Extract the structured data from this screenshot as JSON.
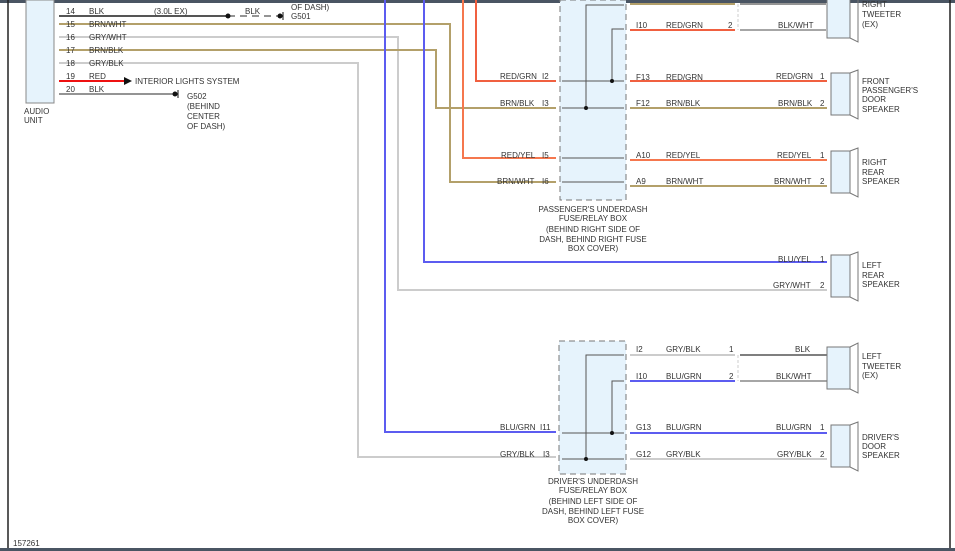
{
  "colors": {
    "red": "#f06040",
    "orange": "#f5774e",
    "brown": "#b3a06a",
    "gray": "#cccccc",
    "blue": "#5c5cf0",
    "black": "#555555",
    "box_fill": "#e6f3fc",
    "frame": "#4a5563"
  },
  "audio_unit": {
    "label1": "AUDIO",
    "label2": "UNIT",
    "pins": [
      {
        "num": "14",
        "wire": "BLK"
      },
      {
        "num": "15",
        "wire": "BRN/WHT"
      },
      {
        "num": "16",
        "wire": "GRY/WHT"
      },
      {
        "num": "17",
        "wire": "BRN/BLK"
      },
      {
        "num": "18",
        "wire": "GRY/BLK"
      },
      {
        "num": "19",
        "wire": "RED"
      },
      {
        "num": "20",
        "wire": "BLK"
      }
    ]
  },
  "pin14_note": "(3.0L EX)",
  "pin14_dash_wire": "BLK",
  "g501": {
    "label": "G501",
    "note": "OF DASH)"
  },
  "pin19_dest": "INTERIOR LIGHTS SYSTEM",
  "g502": {
    "label": "G502",
    "lines": [
      "(BEHIND",
      "CENTER",
      "OF DASH)"
    ]
  },
  "passenger_box": {
    "title": [
      "PASSENGER'S UNDERDASH",
      "FUSE/RELAY BOX"
    ],
    "location": [
      "(BEHIND RIGHT SIDE OF",
      "DASH, BEHIND RIGHT FUSE",
      "BOX COVER)"
    ],
    "inputs": [
      {
        "wire": "RED/GRN",
        "pin": "I2"
      },
      {
        "wire": "BRN/BLK",
        "pin": "I3"
      },
      {
        "wire": "RED/YEL",
        "pin": "I5"
      },
      {
        "wire": "BRN/WHT",
        "pin": "I6"
      }
    ],
    "outputs": [
      {
        "pin": "I10",
        "wire": "RED/GRN"
      },
      {
        "pin": "F13",
        "wire": "RED/GRN"
      },
      {
        "pin": "F12",
        "wire": "BRN/BLK"
      },
      {
        "pin": "A10",
        "wire": "RED/YEL"
      },
      {
        "pin": "A9",
        "wire": "BRN/WHT"
      }
    ]
  },
  "driver_box": {
    "title": [
      "DRIVER'S UNDERDASH",
      "FUSE/RELAY BOX"
    ],
    "location": [
      "(BEHIND LEFT SIDE OF",
      "DASH, BEHIND LEFT FUSE",
      "BOX COVER)"
    ],
    "inputs": [
      {
        "wire": "BLU/GRN",
        "pin": "I11"
      },
      {
        "wire": "GRY/BLK",
        "pin": "I3"
      }
    ],
    "outputs": [
      {
        "pin": "I2",
        "wire": "GRY/BLK"
      },
      {
        "pin": "I10",
        "wire": "BLU/GRN"
      },
      {
        "pin": "G13",
        "wire": "BLU/GRN"
      },
      {
        "pin": "G12",
        "wire": "GRY/BLK"
      }
    ]
  },
  "speakers": [
    {
      "name": [
        "RIGHT",
        "TWEETER",
        "(EX)"
      ],
      "pin2_conn": "2",
      "pin2_wire": "BLK/WHT"
    },
    {
      "name": [
        "FRONT",
        "PASSENGER'S",
        "DOOR",
        "SPEAKER"
      ],
      "pins": [
        {
          "num": "1",
          "wire": "RED/GRN"
        },
        {
          "num": "2",
          "wire": "BRN/BLK"
        }
      ]
    },
    {
      "name": [
        "RIGHT",
        "REAR",
        "SPEAKER"
      ],
      "pins": [
        {
          "num": "1",
          "wire": "RED/YEL"
        },
        {
          "num": "2",
          "wire": "BRN/WHT"
        }
      ]
    },
    {
      "name": [
        "LEFT",
        "REAR",
        "SPEAKER"
      ],
      "pins": [
        {
          "num": "1",
          "wire": "BLU/YEL"
        },
        {
          "num": "2",
          "wire": "GRY/WHT"
        }
      ]
    },
    {
      "name": [
        "LEFT",
        "TWEETER",
        "(EX)"
      ],
      "pins": [
        {
          "num": "1",
          "wire": "BLK"
        },
        {
          "num": "2",
          "wire": "BLK/WHT"
        }
      ]
    },
    {
      "name": [
        "DRIVER'S",
        "DOOR",
        "SPEAKER"
      ],
      "pins": [
        {
          "num": "1",
          "wire": "BLU/GRN"
        },
        {
          "num": "2",
          "wire": "GRY/BLK"
        }
      ]
    }
  ],
  "figure_id": "157261"
}
